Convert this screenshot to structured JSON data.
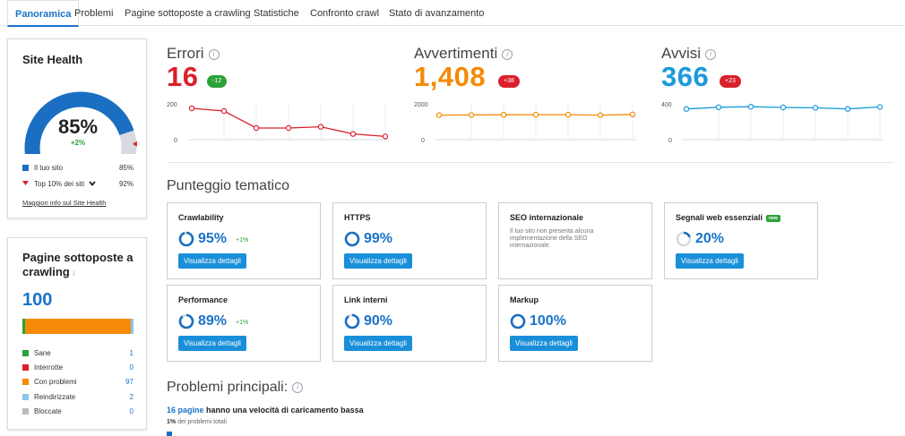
{
  "tabs": [
    {
      "label": "Panoramica",
      "active": true
    },
    {
      "label": "Problemi"
    },
    {
      "label": "Pagine sottoposte a crawling"
    },
    {
      "label": "Statistiche"
    },
    {
      "label": "Confronto crawl"
    },
    {
      "label": "Stato di avanzamento"
    }
  ],
  "site_health": {
    "title": "Site Health",
    "score": "85%",
    "score_fraction": 0.85,
    "delta": "+2%",
    "legend": [
      {
        "label": "Il tuo sito",
        "value": "85%",
        "color": "#1a6fc2"
      },
      {
        "label": "Top 10% dei siti",
        "value": "92%",
        "color": "#d9202b"
      }
    ],
    "link": "Maggiori info sul Site Health"
  },
  "crawled": {
    "title": "Pagine sottoposte a crawling",
    "info": "i",
    "total": "100",
    "items": [
      {
        "label": "Sane",
        "value": "1",
        "count": 1,
        "color": "#2aa33a"
      },
      {
        "label": "Interrotte",
        "value": "0",
        "count": 0,
        "color": "#d9202b"
      },
      {
        "label": "Con problemi",
        "value": "97",
        "count": 97,
        "color": "#f58a07"
      },
      {
        "label": "Reindirizzate",
        "value": "2",
        "count": 2,
        "color": "#8cc4ea"
      },
      {
        "label": "Bloccate",
        "value": "0",
        "count": 0,
        "color": "#b8bcc0"
      }
    ]
  },
  "metrics": [
    {
      "label": "Errori",
      "value": "16",
      "badge": "-12",
      "badge_color": "#2aa33a",
      "color": "#d9202b",
      "y_top": "200",
      "y_bottom": "0",
      "ymax": 200,
      "series": [
        175,
        160,
        65,
        65,
        72,
        32,
        18
      ]
    },
    {
      "label": "Avvertimenti",
      "value": "1,408",
      "badge": "+38",
      "badge_color": "#d9202b",
      "color": "#f58a07",
      "y_top": "2000",
      "y_bottom": "0",
      "ymax": 2000,
      "series": [
        1370,
        1380,
        1390,
        1395,
        1395,
        1370,
        1408
      ]
    },
    {
      "label": "Avvisi",
      "value": "366",
      "badge": "+23",
      "badge_color": "#d9202b",
      "color": "#1a9adb",
      "y_top": "400",
      "y_bottom": "0",
      "ymax": 400,
      "series": [
        343,
        362,
        368,
        360,
        356,
        343,
        366
      ]
    }
  ],
  "thematic": {
    "title": "Punteggio tematico",
    "button_label": "Visualizza dettagli",
    "cards": [
      {
        "title": "Crawlability",
        "score": "95%",
        "fraction": 0.95,
        "delta": "+1%"
      },
      {
        "title": "HTTPS",
        "score": "99%",
        "fraction": 0.99,
        "delta": ""
      },
      {
        "title": "SEO internazionale",
        "note": "Il tuo sito non presenta alcuna implementazione della SEO internazionale."
      },
      {
        "title": "Segnali web essenziali",
        "new": "new",
        "score": "20%",
        "fraction": 0.2,
        "delta": ""
      },
      {
        "title": "Performance",
        "score": "89%",
        "fraction": 0.89,
        "delta": "+1%"
      },
      {
        "title": "Link interni",
        "score": "90%",
        "fraction": 0.9,
        "delta": ""
      },
      {
        "title": "Markup",
        "score": "100%",
        "fraction": 1.0,
        "delta": ""
      }
    ]
  },
  "top_issues": {
    "title": "Problemi principali:",
    "issue_link": "16 pagine",
    "issue_text": "hanno una velocità di caricamento bassa",
    "issue_pct": "1%",
    "issue_sub": "dei problemi totali"
  }
}
